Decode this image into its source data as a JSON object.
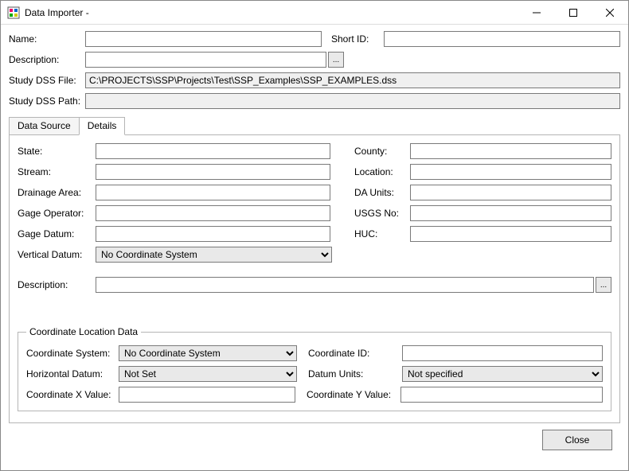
{
  "window": {
    "title": "Data Importer -"
  },
  "top": {
    "name_label": "Name:",
    "name_value": "",
    "short_id_label": "Short ID:",
    "short_id_value": "",
    "description_label": "Description:",
    "description_value": "",
    "study_dss_file_label": "Study DSS File:",
    "study_dss_file_value": "C:\\PROJECTS\\SSP\\Projects\\Test\\SSP_Examples\\SSP_EXAMPLES.dss",
    "study_dss_path_label": "Study DSS Path:",
    "study_dss_path_value": ""
  },
  "tabs": {
    "data_source": "Data Source",
    "details": "Details"
  },
  "details": {
    "state_label": "State:",
    "state_value": "",
    "county_label": "County:",
    "county_value": "",
    "stream_label": "Stream:",
    "stream_value": "",
    "location_label": "Location:",
    "location_value": "",
    "drainage_area_label": "Drainage Area:",
    "drainage_area_value": "",
    "da_units_label": "DA Units:",
    "da_units_value": "",
    "gage_operator_label": "Gage Operator:",
    "gage_operator_value": "",
    "usgs_no_label": "USGS No:",
    "usgs_no_value": "",
    "gage_datum_label": "Gage Datum:",
    "gage_datum_value": "",
    "huc_label": "HUC:",
    "huc_value": "",
    "vertical_datum_label": "Vertical Datum:",
    "vertical_datum_value": "No Coordinate System",
    "description_label": "Description:",
    "description_value": ""
  },
  "coord": {
    "legend": "Coordinate Location Data",
    "system_label": "Coordinate System:",
    "system_value": "No Coordinate System",
    "id_label": "Coordinate ID:",
    "id_value": "",
    "h_datum_label": "Horizontal Datum:",
    "h_datum_value": "Not Set",
    "datum_units_label": "Datum Units:",
    "datum_units_value": "Not specified",
    "x_label": "Coordinate X Value:",
    "x_value": "",
    "y_label": "Coordinate Y Value:",
    "y_value": ""
  },
  "buttons": {
    "close": "Close",
    "ellipsis": "..."
  }
}
